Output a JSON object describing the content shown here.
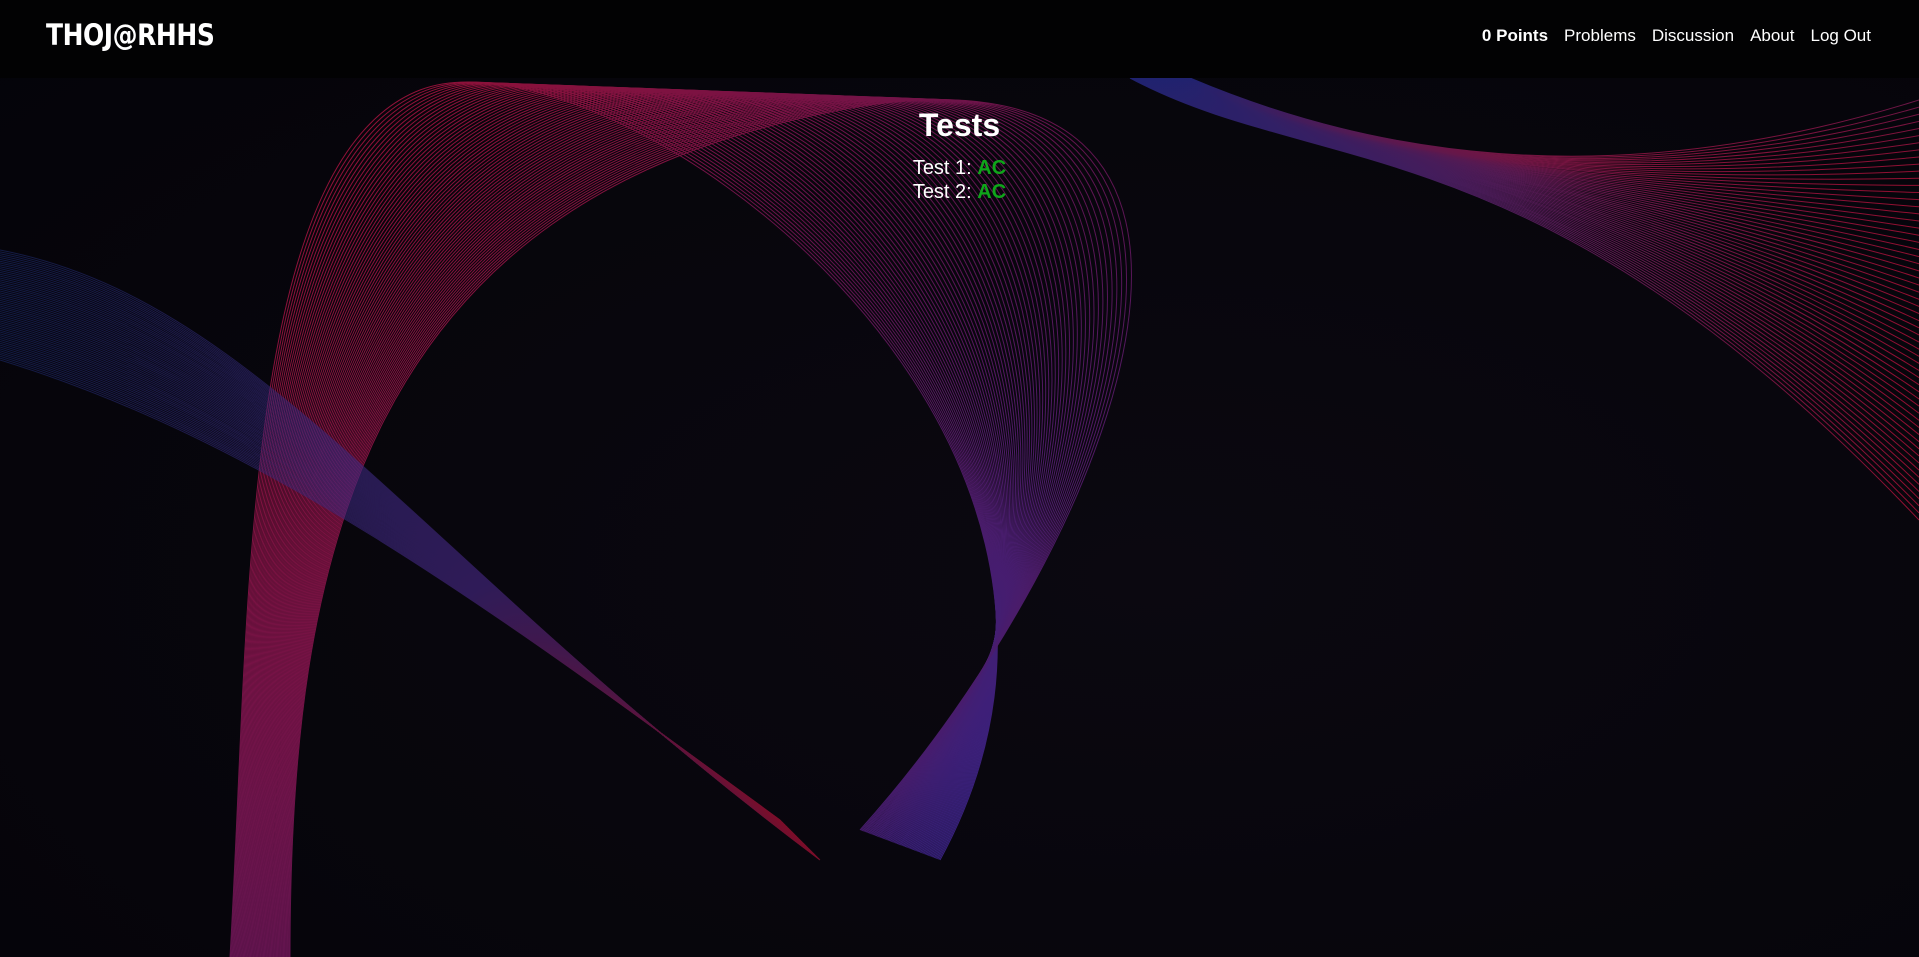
{
  "brand": "THOJ@RHHS",
  "nav": {
    "points": "0 Points",
    "problems": "Problems",
    "discussion": "Discussion",
    "about": "About",
    "logout": "Log Out"
  },
  "main": {
    "title": "Tests",
    "tests": [
      {
        "label": "Test 1:",
        "verdict": "AC"
      },
      {
        "label": "Test 2:",
        "verdict": "AC"
      }
    ]
  },
  "colors": {
    "verdict_ac": "#0fa51a",
    "wave_red": "#c8123c",
    "wave_blue": "#3a2fb0",
    "navbar": "#020203"
  }
}
